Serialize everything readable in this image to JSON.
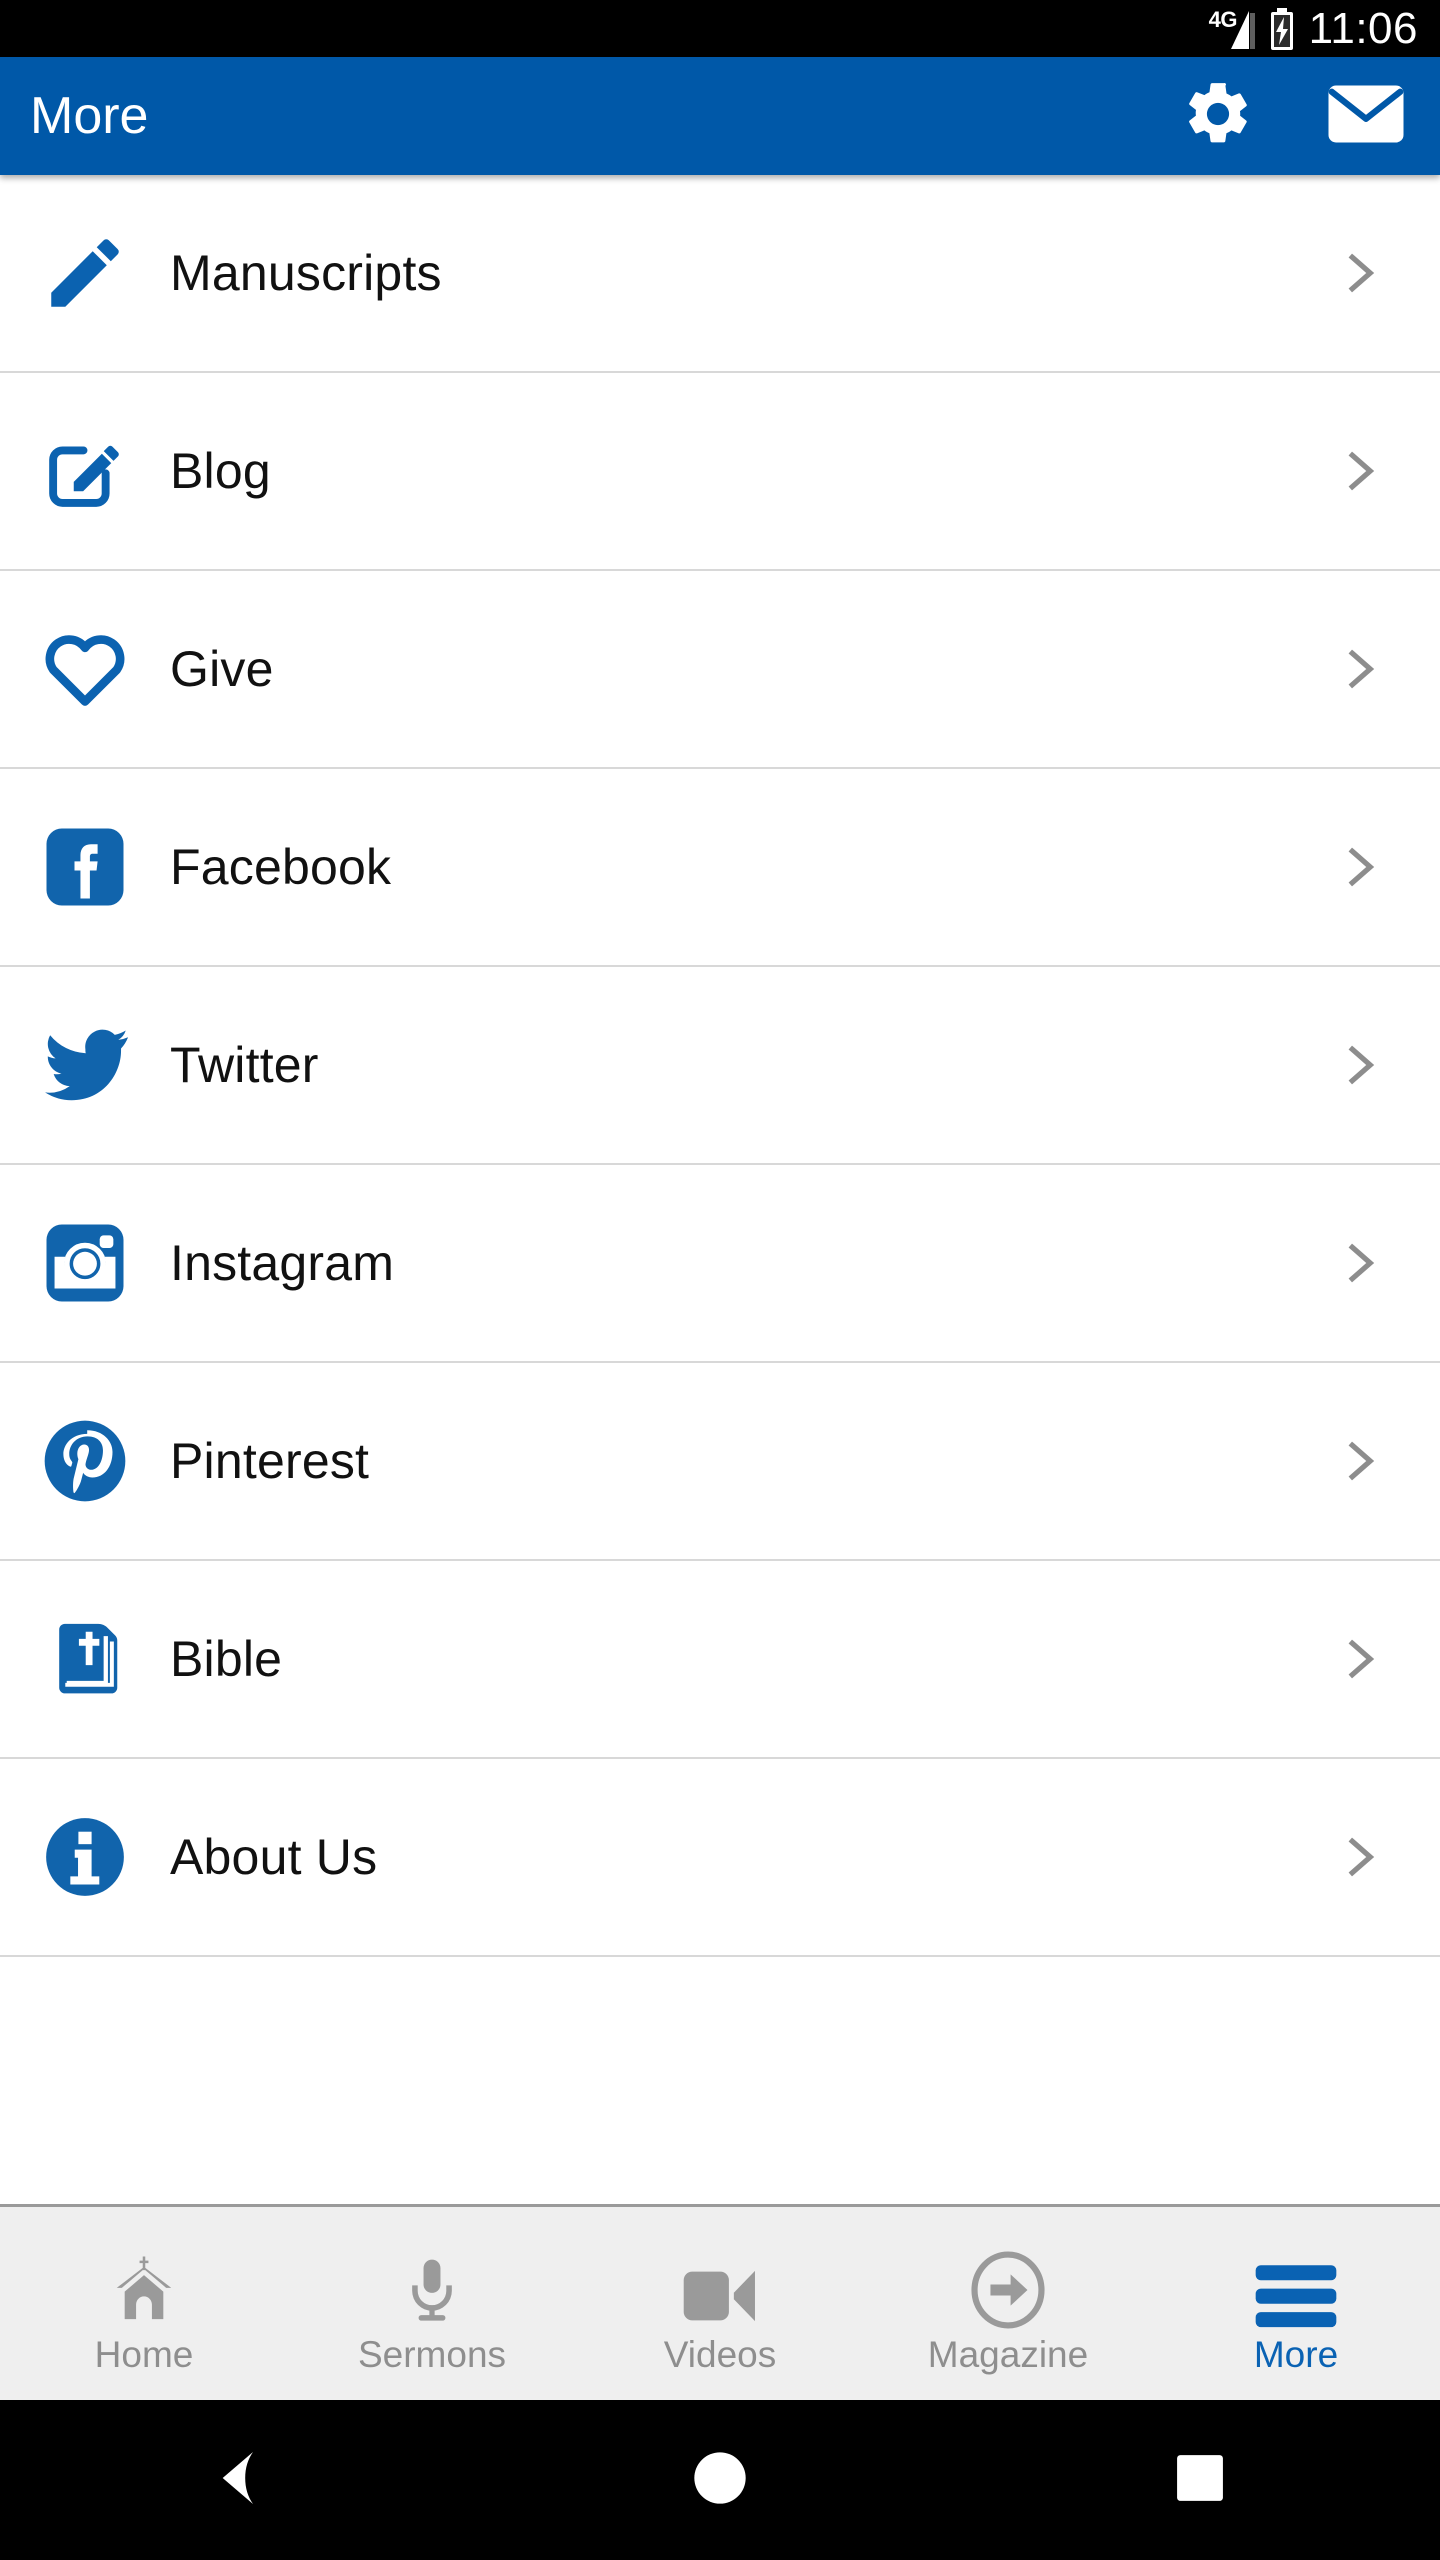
{
  "status_bar": {
    "network": "4G",
    "network_icon": "signal-bars-icon",
    "battery_icon": "battery-charging-icon",
    "time": "11:06"
  },
  "app_bar": {
    "title": "More",
    "background_color": "#0058a8",
    "actions": [
      {
        "name": "settings-button",
        "icon": "gear-icon"
      },
      {
        "name": "mail-button",
        "icon": "envelope-icon"
      }
    ]
  },
  "list": {
    "chevron_icon": "chevron-right-icon",
    "items": [
      {
        "label": "Manuscripts",
        "icon": "pencil-icon",
        "color": "#0b62b0"
      },
      {
        "label": "Blog",
        "icon": "compose-box-icon",
        "color": "#0b62b0"
      },
      {
        "label": "Give",
        "icon": "heart-outline-icon",
        "color": "#0b62b0"
      },
      {
        "label": "Facebook",
        "icon": "facebook-icon",
        "color": "#1164ac"
      },
      {
        "label": "Twitter",
        "icon": "twitter-bird-icon",
        "color": "#1164ac"
      },
      {
        "label": "Instagram",
        "icon": "instagram-icon",
        "color": "#1164ac"
      },
      {
        "label": "Pinterest",
        "icon": "pinterest-icon",
        "color": "#1164ac"
      },
      {
        "label": "Bible",
        "icon": "bible-book-icon",
        "color": "#1164ac"
      },
      {
        "label": "About Us",
        "icon": "info-circle-icon",
        "color": "#1164ac"
      }
    ]
  },
  "tab_bar": {
    "active_color": "#0a62b3",
    "inactive_color": "#8e8e8e",
    "tabs": [
      {
        "label": "Home",
        "icon": "church-icon",
        "active": false
      },
      {
        "label": "Sermons",
        "icon": "microphone-icon",
        "active": false
      },
      {
        "label": "Videos",
        "icon": "video-camera-icon",
        "active": false
      },
      {
        "label": "Magazine",
        "icon": "arrow-circle-icon",
        "active": false
      },
      {
        "label": "More",
        "icon": "hamburger-menu-icon",
        "active": true
      }
    ]
  },
  "nav_bar": {
    "buttons": [
      {
        "name": "back-button",
        "icon": "triangle-back-icon"
      },
      {
        "name": "home-button",
        "icon": "circle-home-icon"
      },
      {
        "name": "recents-button",
        "icon": "square-recents-icon"
      }
    ]
  }
}
